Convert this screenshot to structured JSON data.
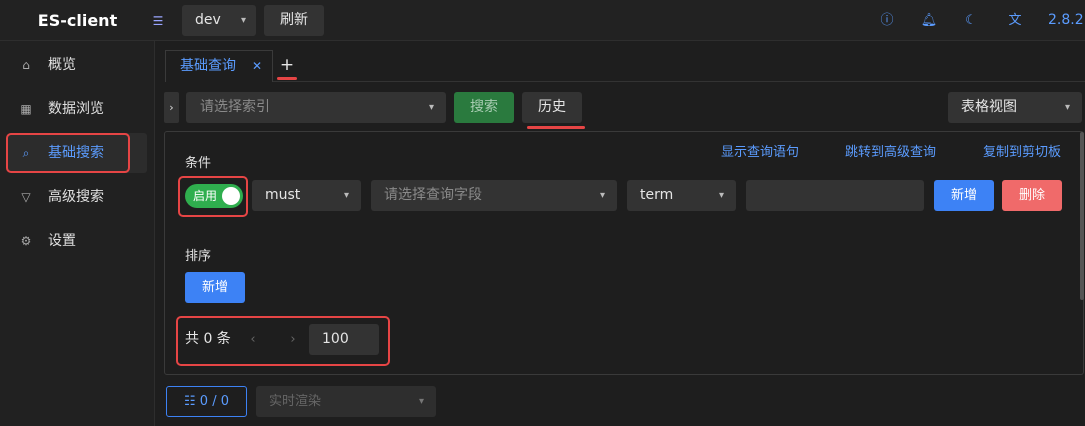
{
  "header": {
    "brand": "ES-client",
    "env_value": "dev",
    "refresh_label": "刷新",
    "version": "2.8.2",
    "icons": [
      "info-icon",
      "bell-icon",
      "moon-icon",
      "translate-icon"
    ]
  },
  "sidebar": {
    "items": [
      {
        "label": "概览",
        "icon": "home-icon"
      },
      {
        "label": "数据浏览",
        "icon": "grid-icon"
      },
      {
        "label": "基础搜索",
        "icon": "search-icon"
      },
      {
        "label": "高级搜索",
        "icon": "filter-icon"
      },
      {
        "label": "设置",
        "icon": "gear-icon"
      }
    ],
    "active": "基础搜索"
  },
  "tabs": {
    "items": [
      {
        "label": "基础查询"
      }
    ],
    "add_label": "+"
  },
  "toolbar": {
    "index_placeholder": "请选择索引",
    "search_label": "搜索",
    "history_label": "历史",
    "view_value": "表格视图"
  },
  "panel": {
    "links": {
      "show_query": "显示查询语句",
      "goto_advanced": "跳转到高级查询",
      "copy_clipboard": "复制到剪切板"
    },
    "condition_label": "条件",
    "switch_label": "启用",
    "bool_value": "must",
    "field_placeholder": "请选择查询字段",
    "operator_value": "term",
    "query_value": "",
    "add_label": "新增",
    "delete_label": "删除",
    "sort_label": "排序",
    "sort_add_label": "新增",
    "pagination": {
      "total_text": "共 0 条",
      "prev": "‹",
      "next": "›",
      "page_size": "100"
    }
  },
  "footer": {
    "count_text": "0 / 0",
    "render_placeholder": "实时渲染"
  },
  "colors": {
    "accent": "#5b9cff",
    "success": "#2fae4e",
    "danger": "#f06a6a",
    "annotation": "#e64545"
  }
}
